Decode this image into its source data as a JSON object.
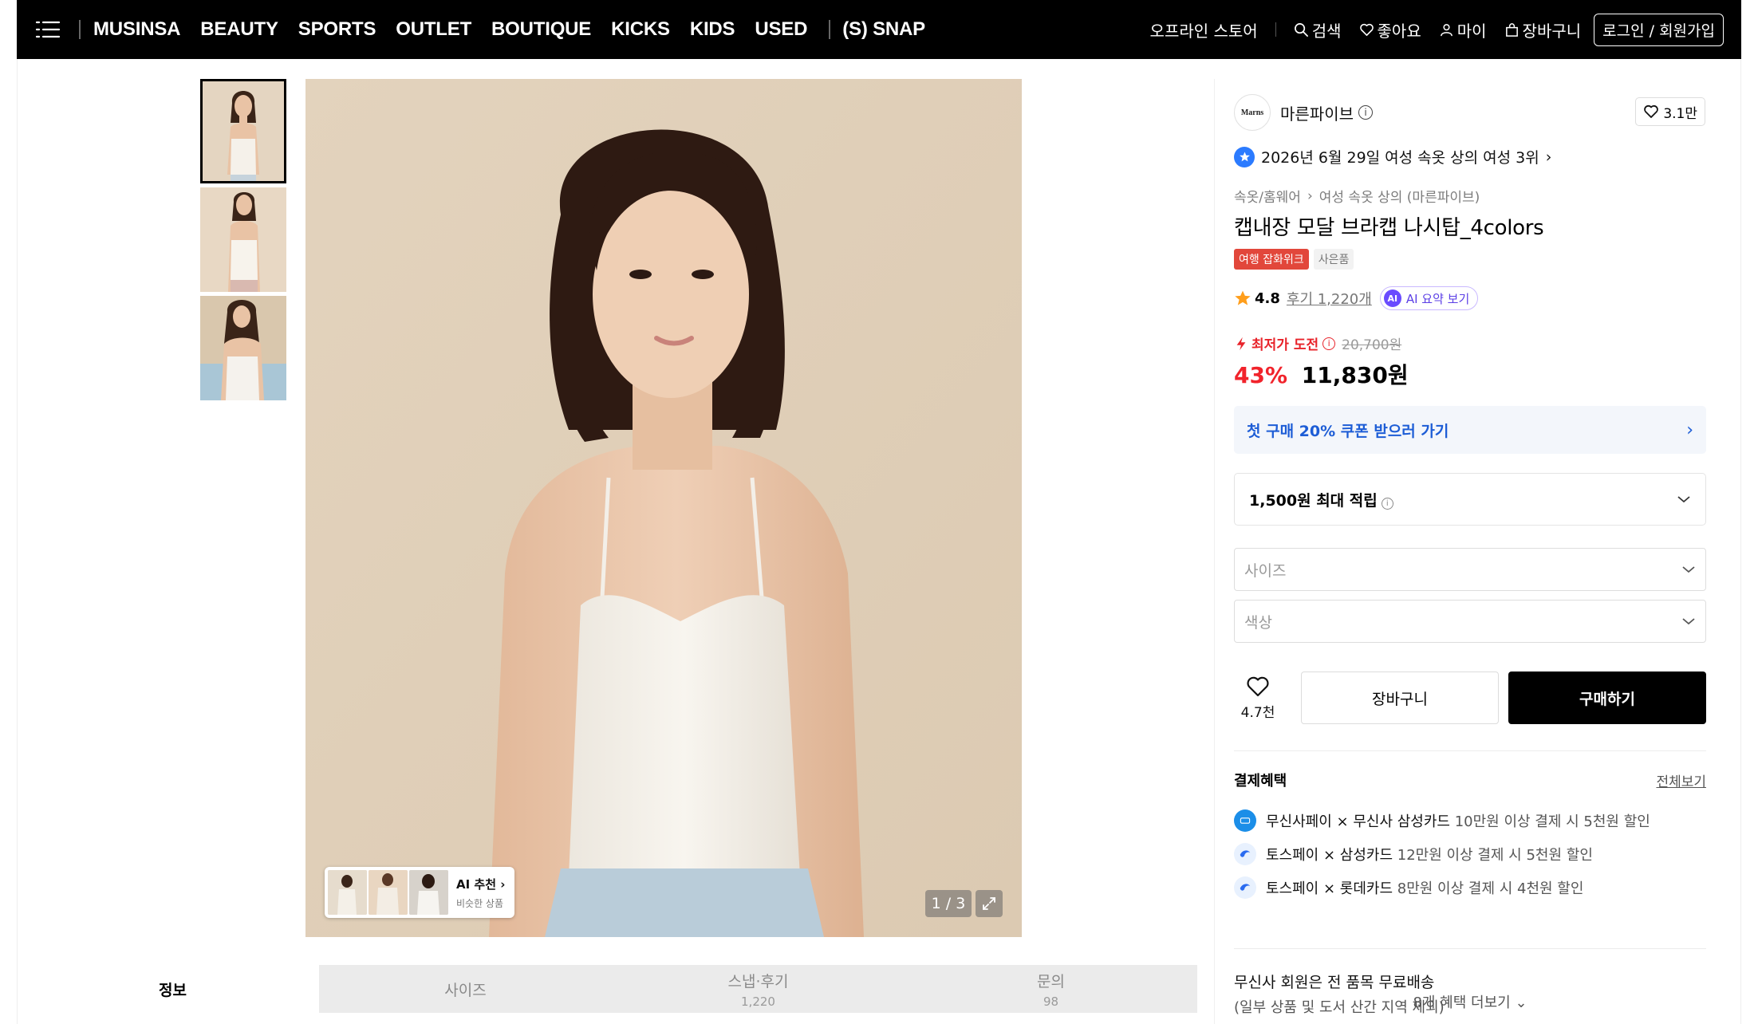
{
  "nav": {
    "links": [
      "MUSINSA",
      "BEAUTY",
      "SPORTS",
      "OUTLET",
      "BOUTIQUE",
      "KICKS",
      "KIDS",
      "USED"
    ],
    "snap": "(S) SNAP",
    "offline_store": "오프라인 스토어",
    "search": "검색",
    "likes": "좋아요",
    "my": "마이",
    "cart": "장바구니",
    "login": "로그인 / 회원가입"
  },
  "gallery": {
    "ai_title": "AI 추천",
    "ai_sub": "비슷한 상품",
    "pager": "1 / 3"
  },
  "tabs": [
    {
      "label": "정보",
      "count": ""
    },
    {
      "label": "사이즈",
      "count": ""
    },
    {
      "label": "스냅·후기",
      "count": "1,220"
    },
    {
      "label": "문의",
      "count": "98"
    }
  ],
  "product": {
    "brand_logo": "Marns",
    "brand": "마른파이브",
    "brand_likes": "3.1만",
    "rank": "2026년 6월 29일 여성 속옷 상의 여성 3위",
    "crumb_1": "속옷/홈웨어",
    "crumb_2": "여성 속옷 상의 (마른파이브)",
    "title": "캡내장 모달 브라캡 나시탑_4colors",
    "tag_1": "여행 잡화위크",
    "tag_2": "사은품",
    "rating": "4.8",
    "reviews": "후기 1,220개",
    "ai_summary": "AI 요약 보기",
    "ai_dot": "AI",
    "lowest_label": "최저가 도전",
    "original_price": "20,700원",
    "discount": "43%",
    "price": "11,830원",
    "coupon": "첫 구매 20% 쿠폰 받으러 가기",
    "points": "1,500원 최대 적립",
    "size_placeholder": "사이즈",
    "color_placeholder": "색상",
    "wish_count": "4.7천",
    "cart_button": "장바구니",
    "buy_button": "구매하기"
  },
  "payment": {
    "title": "결제혜택",
    "view_all": "전체보기",
    "items": [
      {
        "name": "무신사페이 × 무신사 삼성카드",
        "detail": "10만원 이상 결제 시 5천원 할인"
      },
      {
        "name": "토스페이 × 삼성카드",
        "detail": "12만원 이상 결제 시 5천원 할인"
      },
      {
        "name": "토스페이 × 롯데카드",
        "detail": "8만원 이상 결제 시 4천원 할인"
      }
    ],
    "more": "8개 혜택 더보기"
  },
  "shipping": {
    "line1": "무신사 회원은 전 품목 무료배송",
    "line2": "(일부 상품 및 도서 산간 지역 제외)"
  },
  "colors": {
    "accent_red": "#f1232b",
    "coupon_blue": "#1d5dd6",
    "rank_blue": "#2b7bff",
    "ai_purple": "#6a4bff"
  }
}
